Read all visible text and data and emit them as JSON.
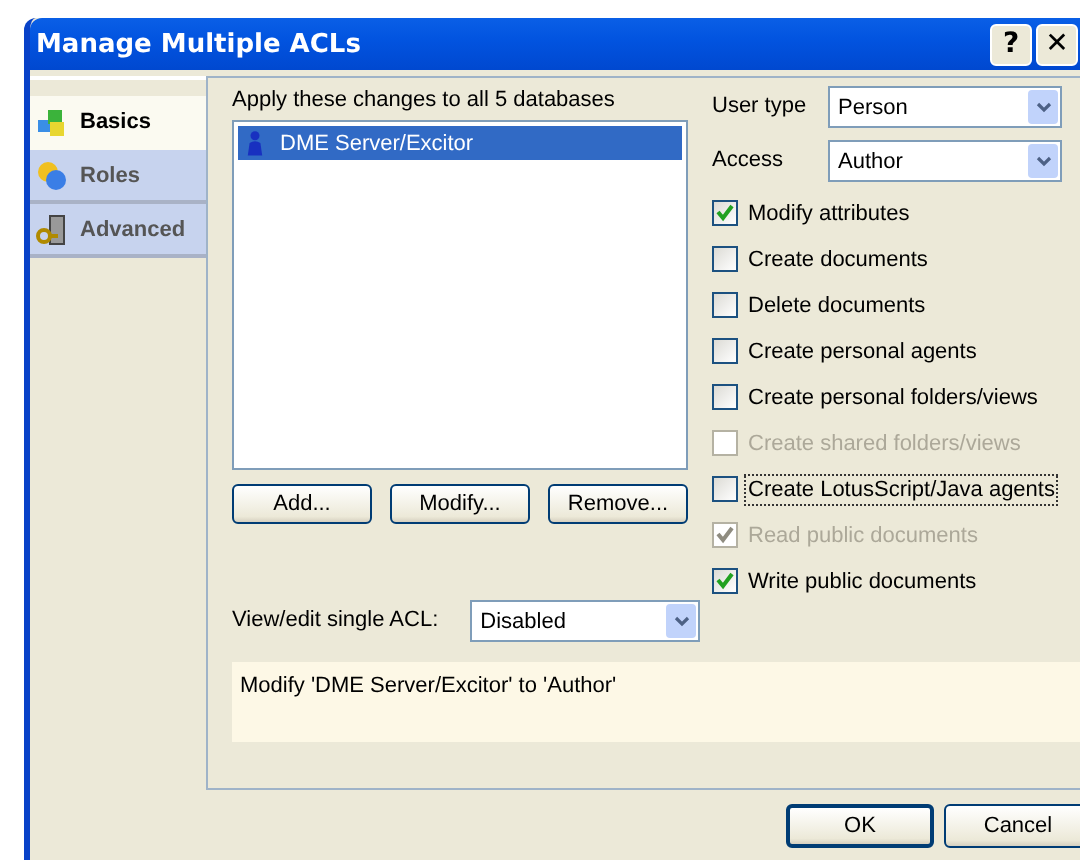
{
  "window": {
    "title": "Manage Multiple ACLs",
    "buttons": [
      "?",
      "✕"
    ]
  },
  "sidebar": {
    "items": [
      {
        "label": "Basics",
        "selected": true,
        "kind": "basics"
      },
      {
        "label": "Roles",
        "selected": false,
        "kind": "roles"
      },
      {
        "label": "Advanced",
        "selected": false,
        "kind": "advanced"
      }
    ]
  },
  "apply_label": "Apply these changes to all 5 databases",
  "entries": [
    {
      "name": "DME Server/Excitor",
      "selected": true
    }
  ],
  "list_buttons": [
    "Add...",
    "Modify...",
    "Remove..."
  ],
  "single_acl": {
    "label": "View/edit single ACL:",
    "value": "Disabled"
  },
  "message": "Modify 'DME Server/Excitor' to 'Author'",
  "user_type": {
    "label": "User type",
    "value": "Person"
  },
  "access": {
    "label": "Access",
    "value": "Author"
  },
  "options": [
    {
      "label": "Modify attributes",
      "checked": true,
      "disabled": false,
      "focused": false
    },
    {
      "label": "Create documents",
      "checked": false,
      "disabled": false,
      "focused": false
    },
    {
      "label": "Delete documents",
      "checked": false,
      "disabled": false,
      "focused": false
    },
    {
      "label": "Create personal agents",
      "checked": false,
      "disabled": false,
      "focused": false
    },
    {
      "label": "Create personal folders/views",
      "checked": false,
      "disabled": false,
      "focused": false
    },
    {
      "label": "Create shared folders/views",
      "checked": false,
      "disabled": true,
      "focused": false
    },
    {
      "label": "Create LotusScript/Java agents",
      "checked": false,
      "disabled": false,
      "focused": true
    },
    {
      "label": "Read public documents",
      "checked": true,
      "disabled": true,
      "focused": false
    },
    {
      "label": "Write public documents",
      "checked": true,
      "disabled": false,
      "focused": false
    }
  ],
  "dialog_buttons": [
    "OK",
    "Cancel"
  ]
}
